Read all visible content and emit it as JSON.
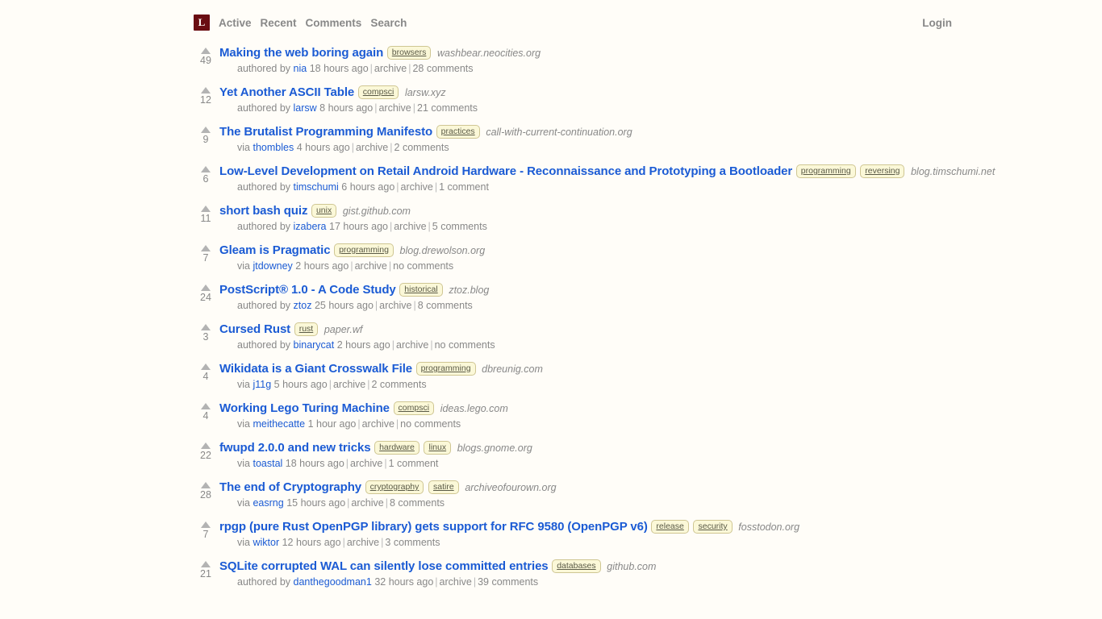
{
  "header": {
    "logo_letter": "L",
    "nav": [
      {
        "label": "Active"
      },
      {
        "label": "Recent"
      },
      {
        "label": "Comments"
      },
      {
        "label": "Search"
      }
    ],
    "login_label": "Login"
  },
  "separator": "|",
  "stories": [
    {
      "score": "49",
      "title": "Making the web boring again",
      "tags": [
        "browsers"
      ],
      "domain": "washbear.neocities.org",
      "attribution": "authored by",
      "author": "nia",
      "age": "18 hours ago",
      "archive": "archive",
      "comments": "28 comments"
    },
    {
      "score": "12",
      "title": "Yet Another ASCII Table",
      "tags": [
        "compsci"
      ],
      "domain": "larsw.xyz",
      "attribution": "authored by",
      "author": "larsw",
      "age": "8 hours ago",
      "archive": "archive",
      "comments": "21 comments"
    },
    {
      "score": "9",
      "title": "The Brutalist Programming Manifesto",
      "tags": [
        "practices"
      ],
      "domain": "call-with-current-continuation.org",
      "attribution": "via",
      "author": "thombles",
      "age": "4 hours ago",
      "archive": "archive",
      "comments": "2 comments"
    },
    {
      "score": "6",
      "title": "Low-Level Development on Retail Android Hardware - Reconnaissance and Prototyping a Bootloader",
      "tags": [
        "programming",
        "reversing"
      ],
      "domain": "blog.timschumi.net",
      "attribution": "authored by",
      "author": "timschumi",
      "age": "6 hours ago",
      "archive": "archive",
      "comments": "1 comment"
    },
    {
      "score": "11",
      "title": "short bash quiz",
      "tags": [
        "unix"
      ],
      "domain": "gist.github.com",
      "attribution": "authored by",
      "author": "izabera",
      "age": "17 hours ago",
      "archive": "archive",
      "comments": "5 comments"
    },
    {
      "score": "7",
      "title": "Gleam is Pragmatic",
      "tags": [
        "programming"
      ],
      "domain": "blog.drewolson.org",
      "attribution": "via",
      "author": "jtdowney",
      "age": "2 hours ago",
      "archive": "archive",
      "comments": "no comments"
    },
    {
      "score": "24",
      "title": "PostScript® 1.0 - A Code Study",
      "tags": [
        "historical"
      ],
      "domain": "ztoz.blog",
      "attribution": "authored by",
      "author": "ztoz",
      "age": "25 hours ago",
      "archive": "archive",
      "comments": "8 comments"
    },
    {
      "score": "3",
      "title": "Cursed Rust",
      "tags": [
        "rust"
      ],
      "domain": "paper.wf",
      "attribution": "authored by",
      "author": "binarycat",
      "age": "2 hours ago",
      "archive": "archive",
      "comments": "no comments"
    },
    {
      "score": "4",
      "title": "Wikidata is a Giant Crosswalk File",
      "tags": [
        "programming"
      ],
      "domain": "dbreunig.com",
      "attribution": "via",
      "author": "j11g",
      "age": "5 hours ago",
      "archive": "archive",
      "comments": "2 comments"
    },
    {
      "score": "4",
      "title": "Working Lego Turing Machine",
      "tags": [
        "compsci"
      ],
      "domain": "ideas.lego.com",
      "attribution": "via",
      "author": "meithecatte",
      "age": "1 hour ago",
      "archive": "archive",
      "comments": "no comments"
    },
    {
      "score": "22",
      "title": "fwupd 2.0.0 and new tricks",
      "tags": [
        "hardware",
        "linux"
      ],
      "domain": "blogs.gnome.org",
      "attribution": "via",
      "author": "toastal",
      "age": "18 hours ago",
      "archive": "archive",
      "comments": "1 comment"
    },
    {
      "score": "28",
      "title": "The end of Cryptography",
      "tags": [
        "cryptography",
        "satire"
      ],
      "domain": "archiveofourown.org",
      "attribution": "via",
      "author": "easrng",
      "age": "15 hours ago",
      "archive": "archive",
      "comments": "8 comments"
    },
    {
      "score": "7",
      "title": "rpgp (pure Rust OpenPGP library) gets support for RFC 9580 (OpenPGP v6)",
      "tags": [
        "release",
        "security"
      ],
      "domain": "fosstodon.org",
      "attribution": "via",
      "author": "wiktor",
      "age": "12 hours ago",
      "archive": "archive",
      "comments": "3 comments"
    },
    {
      "score": "21",
      "title": "SQLite corrupted WAL can silently lose committed entries",
      "tags": [
        "databases"
      ],
      "domain": "github.com",
      "attribution": "authored by",
      "author": "danthegoodman1",
      "age": "32 hours ago",
      "archive": "archive",
      "comments": "39 comments"
    }
  ],
  "colors": {
    "page_bg": "#fffdf8",
    "link_blue": "#1b5bd4",
    "logo_maroon": "#6a0d12",
    "tag_bg": "#fbf8d8",
    "tag_border": "#cfc693",
    "muted_text": "#888888"
  }
}
